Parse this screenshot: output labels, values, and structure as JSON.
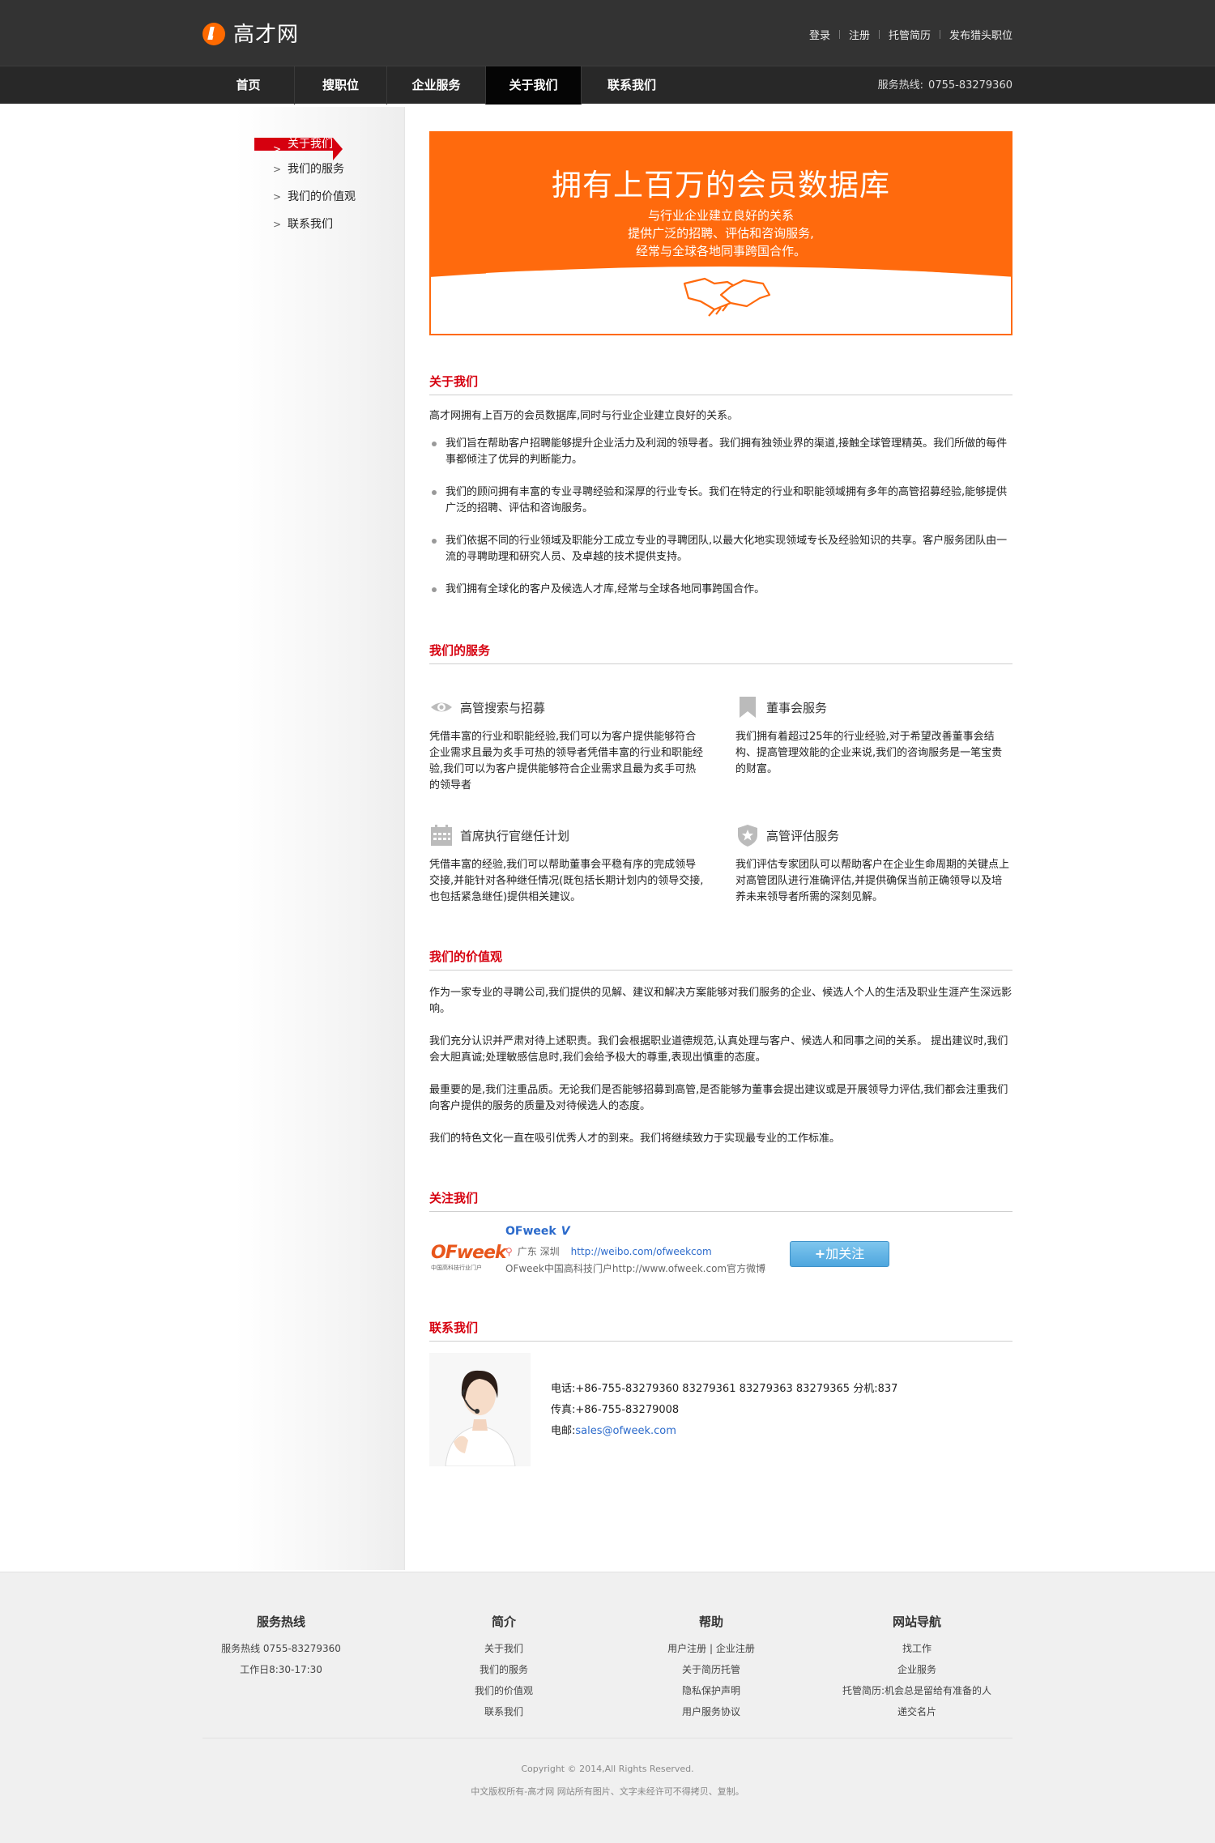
{
  "header": {
    "logo_text": "高才网",
    "links": [
      "登录",
      "注册",
      "托管简历",
      "发布猎头职位"
    ]
  },
  "nav": {
    "items": [
      "首页",
      "搜职位",
      "企业服务",
      "关于我们",
      "联系我们"
    ],
    "active_index": 3,
    "hotline_label": "服务热线:",
    "hotline_number": "0755-83279360"
  },
  "sidebar": {
    "items": [
      "关于我们",
      "我们的服务",
      "我们的价值观",
      "联系我们"
    ],
    "active_index": 0
  },
  "banner": {
    "title": "拥有上百万的会员数据库",
    "lines": [
      "与行业企业建立良好的关系",
      "提供广泛的招聘、评估和咨询服务,",
      "经常与全球各地同事跨国合作。"
    ]
  },
  "about": {
    "title": "关于我们",
    "intro": "高才网拥有上百万的会员数据库,同时与行业企业建立良好的关系。",
    "bullets": [
      "我们旨在帮助客户招聘能够提升企业活力及利润的领导者。我们拥有独领业界的渠道,接触全球管理精英。我们所做的每件事都倾注了优异的判断能力。",
      "我们的顾问拥有丰富的专业寻聘经验和深厚的行业专长。我们在特定的行业和职能领域拥有多年的高管招募经验,能够提供广泛的招聘、评估和咨询服务。",
      "我们依据不同的行业领域及职能分工成立专业的寻聘团队,以最大化地实现领域专长及经验知识的共享。客户服务团队由一流的寻聘助理和研究人员、及卓越的技术提供支持。",
      "我们拥有全球化的客户及候选人才库,经常与全球各地同事跨国合作。"
    ]
  },
  "services": {
    "title": "我们的服务",
    "items": [
      {
        "icon": "eye-icon",
        "name": "高管搜索与招募",
        "text": "凭借丰富的行业和职能经验,我们可以为客户提供能够符合企业需求且最为炙手可热的领导者凭借丰富的行业和职能经验,我们可以为客户提供能够符合企业需求且最为炙手可热的领导者"
      },
      {
        "icon": "bookmark-icon",
        "name": "董事会服务",
        "text": "我们拥有着超过25年的行业经验,对于希望改善董事会结构、提高管理效能的企业来说,我们的咨询服务是一笔宝贵的财富。"
      },
      {
        "icon": "calendar-icon",
        "name": "首席执行官继任计划",
        "text": "凭借丰富的经验,我们可以帮助董事会平稳有序的完成领导交接,并能针对各种继任情况(既包括长期计划内的领导交接,也包括紧急继任)提供相关建议。"
      },
      {
        "icon": "shield-star-icon",
        "name": "高管评估服务",
        "text": "我们评估专家团队可以帮助客户在企业生命周期的关键点上对高管团队进行准确评估,并提供确保当前正确领导以及培养未来领导者所需的深刻见解。"
      }
    ]
  },
  "values": {
    "title": "我们的价值观",
    "paragraphs": [
      "作为一家专业的寻聘公司,我们提供的见解、建议和解决方案能够对我们服务的企业、候选人个人的生活及职业生涯产生深远影响。",
      "我们充分认识并严肃对待上述职责。我们会根据职业道德规范,认真处理与客户、候选人和同事之间的关系。 提出建议时,我们会大胆真诚;处理敏感信息时,我们会给予极大的尊重,表现出慎重的态度。",
      "最重要的是,我们注重品质。无论我们是否能够招募到高管,是否能够为董事会提出建议或是开展领导力评估,我们都会注重我们向客户提供的服务的质量及对待候选人的态度。",
      "我们的特色文化一直在吸引优秀人才的到来。我们将继续致力于实现最专业的工作标准。"
    ]
  },
  "follow": {
    "title": "关注我们",
    "logo_word": "OFweek",
    "logo_sub": "中国高科技行业门户",
    "account": "OFweek",
    "location": "广东 深圳",
    "url": "http://weibo.com/ofweekcom",
    "desc": "OFweek中国高科技门户http://www.ofweek.com官方微博",
    "button": "加关注"
  },
  "contact": {
    "title": "联系我们",
    "phone": "电话:+86-755-83279360 83279361 83279363 83279365 分机:837",
    "fax": "传真:+86-755-83279008",
    "email_label": "电邮:",
    "email": "sales@ofweek.com"
  },
  "footer": {
    "columns": [
      {
        "title": "服务热线",
        "items": [
          "服务热线 0755-83279360",
          "工作日8:30-17:30"
        ]
      },
      {
        "title": "简介",
        "items": [
          "关于我们",
          "我们的服务",
          "我们的价值观",
          "联系我们"
        ]
      },
      {
        "title": "帮助",
        "items": [
          "用户注册 | 企业注册",
          "关于简历托管",
          "隐私保护声明",
          "用户服务协议"
        ]
      },
      {
        "title": "网站导航",
        "items": [
          "找工作",
          "企业服务",
          "托管简历:机会总是留给有准备的人",
          "递交名片"
        ]
      }
    ],
    "copyright": "Copyright © 2014,All Rights Reserved.",
    "notice": "中文版权所有-高才网 网站所有图片、文字未经许可不得拷贝、复制。"
  },
  "colors": {
    "accent_red": "#d6000f",
    "banner_orange": "#ff6a0d",
    "link_blue": "#2b6acb",
    "header_bg": "#333333"
  }
}
